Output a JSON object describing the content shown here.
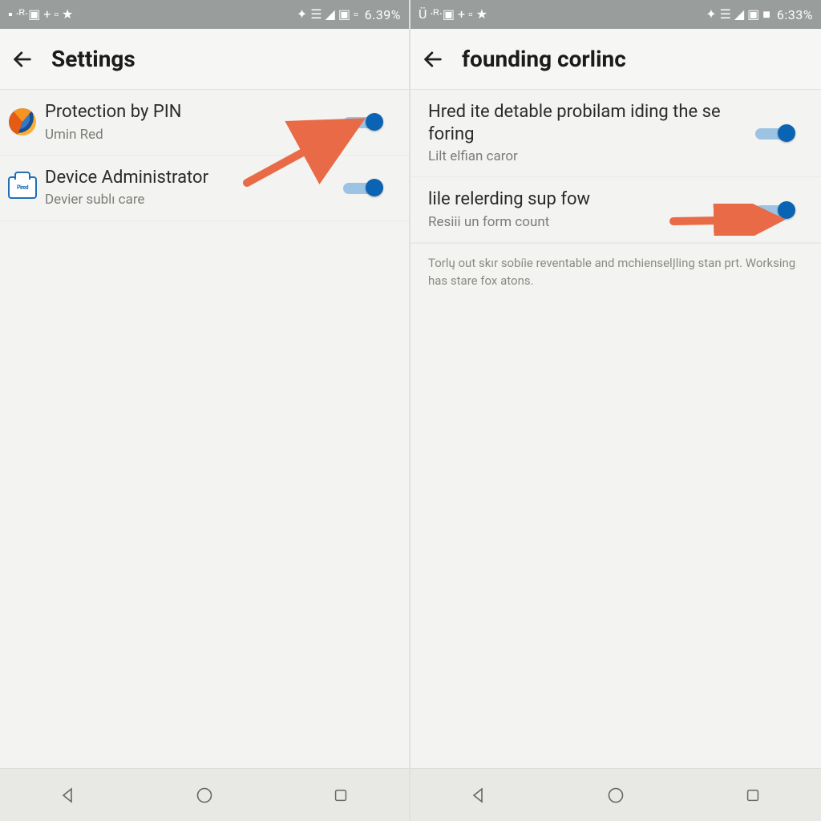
{
  "left": {
    "status": {
      "left_glyphs": "▪ ·ᴿ·▣  +  ▫  ★",
      "right_glyphs": "✦  ☰  ◢  ▣ ▫",
      "battery": "6.39%"
    },
    "appbar": {
      "title": "Settings"
    },
    "items": [
      {
        "title": "Protection by PIN",
        "subtitle": "Umin Red",
        "toggle_on": true,
        "icon": "firefox"
      },
      {
        "title": "Device Administrator",
        "subtitle": "Devier sublı care",
        "toggle_on": true,
        "icon": "device-admin"
      }
    ]
  },
  "right": {
    "status": {
      "left_glyphs": "Ü ·ᴿ·▣  +  ▫  ★",
      "right_glyphs": "✦  ☰  ◢  ▣ ■",
      "battery": "6:33%"
    },
    "appbar": {
      "title": "founding corlinc"
    },
    "items": [
      {
        "title": "Hred ite detable probilam iding the se foring",
        "subtitle": "Lilt elfian caror",
        "toggle_on": true
      },
      {
        "title": "lile relerding sup fow",
        "subtitle": "Resiii un form count",
        "toggle_on": true
      }
    ],
    "footer_note": "Torlų out skır sobíie reventable and mchienselĮling stan prt. Worksing has stare fox atons."
  },
  "arrow_color": "#e96a47"
}
